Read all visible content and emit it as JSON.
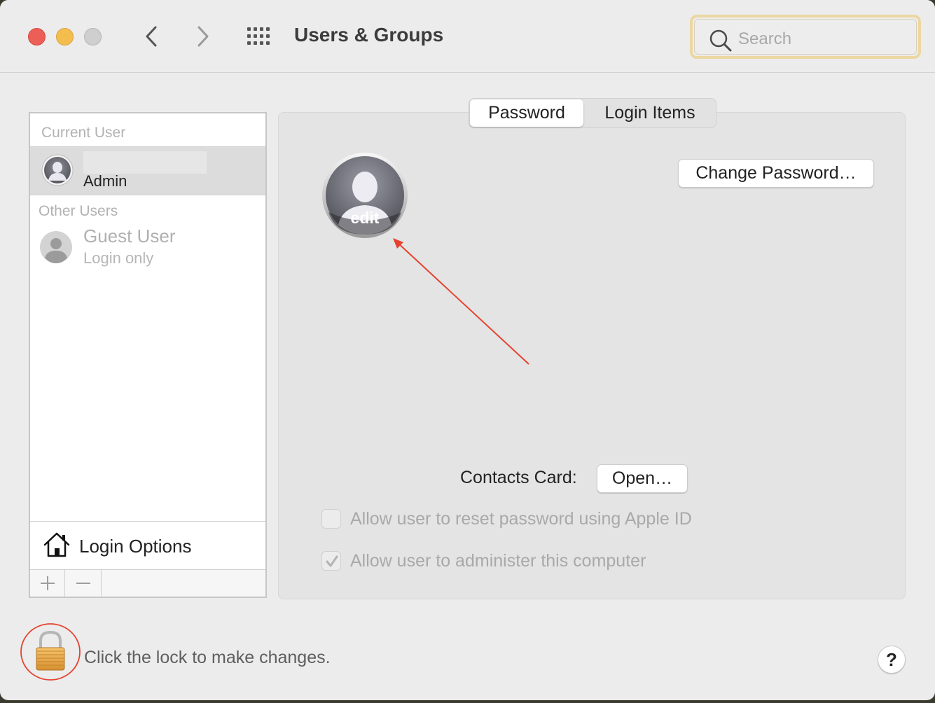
{
  "window": {
    "title": "Users & Groups"
  },
  "toolbar": {
    "back_icon": "chevron-left-icon",
    "forward_icon": "chevron-right-icon",
    "grid_icon": "show-all-grid-icon"
  },
  "search": {
    "placeholder": "Search",
    "value": ""
  },
  "sidebar": {
    "current_user_header": "Current User",
    "current_user": {
      "name": "",
      "role": "Admin"
    },
    "other_users_header": "Other Users",
    "other_users": [
      {
        "name": "Guest User",
        "subtitle": "Login only"
      }
    ],
    "login_options_label": "Login Options",
    "add_label": "+",
    "remove_label": "−"
  },
  "tabs": [
    {
      "label": "Password",
      "selected": true
    },
    {
      "label": "Login Items",
      "selected": false
    }
  ],
  "main": {
    "avatar_edit_label": "edit",
    "change_password_label": "Change Password…",
    "contacts_card_label": "Contacts Card:",
    "open_button_label": "Open…",
    "reset_password_checkbox": {
      "label": "Allow user to reset password using Apple ID",
      "checked": false,
      "enabled": false
    },
    "administer_checkbox": {
      "label": "Allow user to administer this computer",
      "checked": true,
      "enabled": false
    }
  },
  "footer": {
    "lock_text": "Click the lock to make changes.",
    "help_label": "?"
  },
  "colors": {
    "annotation_red": "#e5432f",
    "search_focus_ring": "#ebd7a2"
  }
}
